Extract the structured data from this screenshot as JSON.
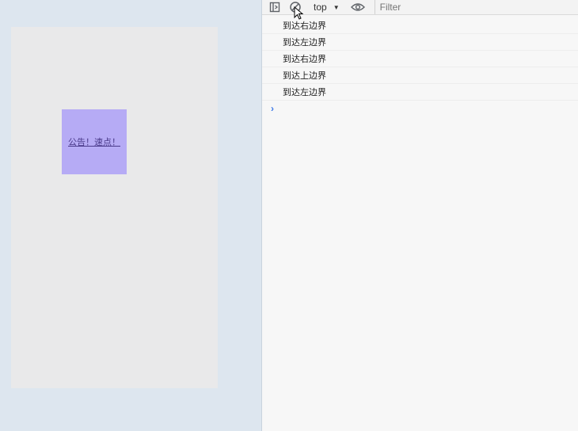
{
  "page": {
    "floating_link_text": "公告！速点！"
  },
  "devtools": {
    "toolbar": {
      "sidebar_icon": "sidebar-toggle-icon",
      "clear_icon": "clear-console-icon",
      "context_label": "top",
      "eye_icon": "eye-icon",
      "filter_placeholder": "Filter"
    },
    "console_messages": [
      "到达右边界",
      "到达左边界",
      "到达右边界",
      "到达上边界",
      "到达左边界"
    ],
    "prompt_icon": "chevron-right-icon"
  },
  "colors": {
    "viewport_bg": "#dde6ef",
    "page_bg": "#e9e9ea",
    "float_box_bg": "#b6abf5",
    "prompt_accent": "#3b78e7"
  }
}
